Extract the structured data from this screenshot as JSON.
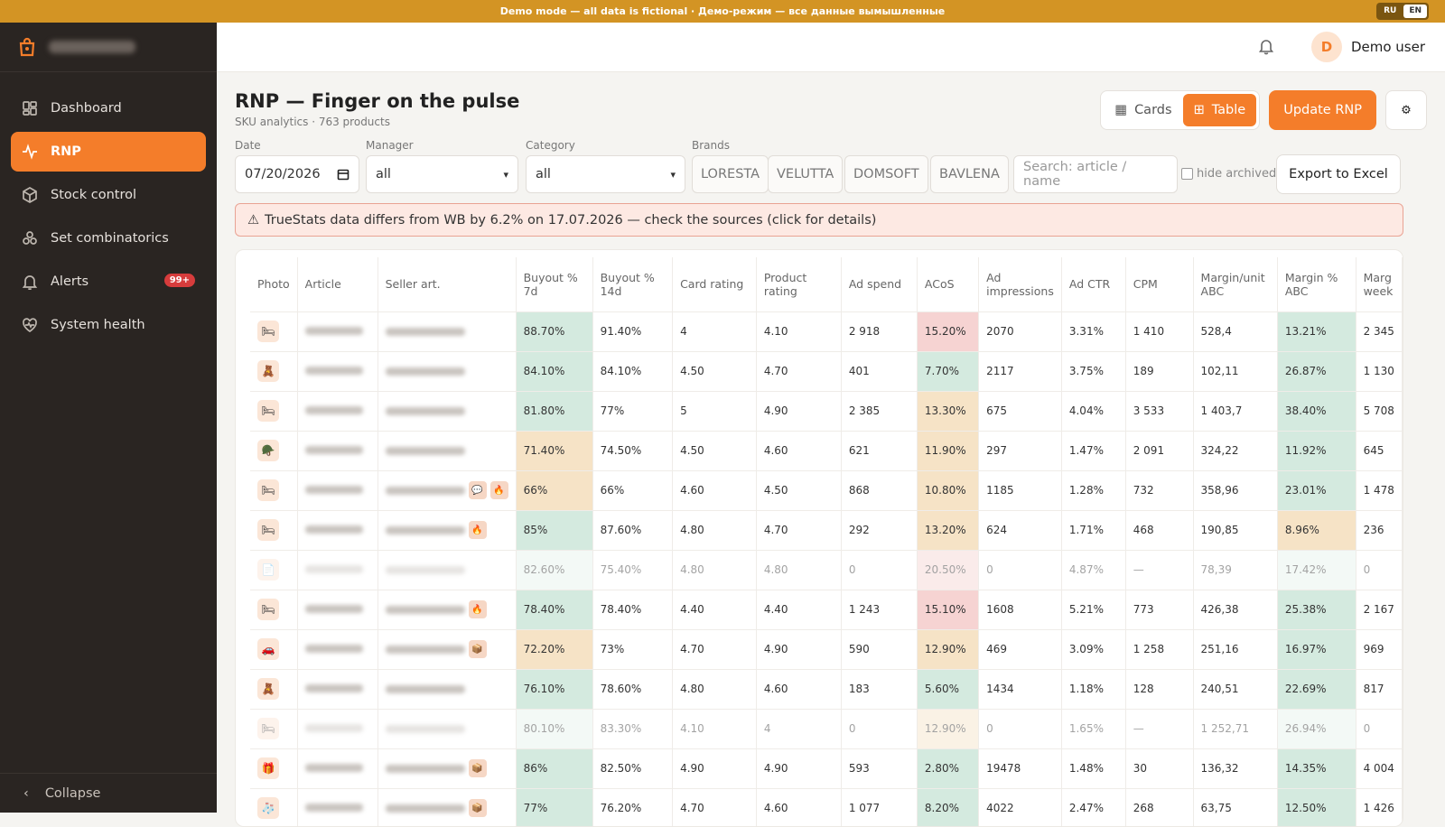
{
  "banner": {
    "text": "Demo mode — all data is fictional · Демо-режим — все данные вымышленные",
    "lang_ru": "RU",
    "lang_en": "EN"
  },
  "sidebar": {
    "items": [
      {
        "label": "Dashboard",
        "icon": "dashboard-icon"
      },
      {
        "label": "RNP",
        "icon": "pulse-icon",
        "active": true
      },
      {
        "label": "Stock control",
        "icon": "box-icon"
      },
      {
        "label": "Set combinatorics",
        "icon": "combinatorics-icon"
      },
      {
        "label": "Alerts",
        "icon": "bell-icon",
        "badge": "99+"
      },
      {
        "label": "System health",
        "icon": "heart-icon"
      }
    ],
    "collapse_label": "Collapse"
  },
  "header": {
    "user_initial": "D",
    "user_name": "Demo user"
  },
  "page": {
    "title": "RNP — Finger on the pulse",
    "subtitle": "SKU analytics · 763 products"
  },
  "toolbar": {
    "cards_label": "Cards",
    "table_label": "Table",
    "update_label": "Update RNP",
    "settings_icon": "gear-icon"
  },
  "filters": {
    "date_label": "Date",
    "date_value": "07/20/2026",
    "manager_label": "Manager",
    "manager_value": "all",
    "category_label": "Category",
    "category_value": "all",
    "brands_label": "Brands",
    "brands": [
      "LORESTA",
      "VELUTTA",
      "DOMSOFT",
      "BAVLENA"
    ],
    "search_placeholder": "Search: article / name",
    "hide_archived_label": "hide archived",
    "export_label": "Export to Excel"
  },
  "alert": {
    "text": "TrueStats data differs from WB by 6.2% on 17.07.2026 — check the sources (click for details)"
  },
  "table": {
    "headers": [
      "Photo",
      "Article",
      "Seller art.",
      "Buyout % 7d",
      "Buyout % 14d",
      "Card rating",
      "Product rating",
      "Ad spend",
      "ACoS",
      "Ad impressions",
      "Ad CTR",
      "CPM",
      "Margin/unit ABC",
      "Margin % ABC",
      "Marg week"
    ],
    "rows": [
      {
        "icon": "🛏",
        "tags": [],
        "dim": false,
        "cells": [
          "88.70%",
          "91.40%",
          "4",
          "4.10",
          "2 918",
          "15.20%",
          "2070",
          "3.31%",
          "1 410",
          "528,4",
          "13.21%",
          "2 345"
        ],
        "colors": [
          "g",
          "",
          "",
          "",
          "",
          "r",
          "",
          "",
          "",
          "",
          "g",
          ""
        ]
      },
      {
        "icon": "🧸",
        "tags": [],
        "dim": false,
        "cells": [
          "84.10%",
          "84.10%",
          "4.50",
          "4.70",
          "401",
          "7.70%",
          "2117",
          "3.75%",
          "189",
          "102,11",
          "26.87%",
          "1 130"
        ],
        "colors": [
          "g",
          "",
          "",
          "",
          "",
          "g",
          "",
          "",
          "",
          "",
          "g",
          ""
        ]
      },
      {
        "icon": "🛏",
        "tags": [],
        "dim": false,
        "cells": [
          "81.80%",
          "77%",
          "5",
          "4.90",
          "2 385",
          "13.30%",
          "675",
          "4.04%",
          "3 533",
          "1 403,7",
          "38.40%",
          "5 708"
        ],
        "colors": [
          "g",
          "",
          "",
          "",
          "",
          "y",
          "",
          "",
          "",
          "",
          "g",
          ""
        ]
      },
      {
        "icon": "🪖",
        "tags": [],
        "dim": false,
        "cells": [
          "71.40%",
          "74.50%",
          "4.50",
          "4.60",
          "621",
          "11.90%",
          "297",
          "1.47%",
          "2 091",
          "324,22",
          "11.92%",
          "645"
        ],
        "colors": [
          "y",
          "",
          "",
          "",
          "",
          "y",
          "",
          "",
          "",
          "",
          "g",
          ""
        ]
      },
      {
        "icon": "🛏",
        "tags": [
          "💬",
          "🔥"
        ],
        "dim": false,
        "cells": [
          "66%",
          "66%",
          "4.60",
          "4.50",
          "868",
          "10.80%",
          "1185",
          "1.28%",
          "732",
          "358,96",
          "23.01%",
          "1 478"
        ],
        "colors": [
          "y",
          "",
          "",
          "",
          "",
          "y",
          "",
          "",
          "",
          "",
          "g",
          ""
        ]
      },
      {
        "icon": "🛏",
        "tags": [
          "🔥"
        ],
        "dim": false,
        "cells": [
          "85%",
          "87.60%",
          "4.80",
          "4.70",
          "292",
          "13.20%",
          "624",
          "1.71%",
          "468",
          "190,85",
          "8.96%",
          "236"
        ],
        "colors": [
          "g",
          "",
          "",
          "",
          "",
          "y",
          "",
          "",
          "",
          "",
          "y",
          ""
        ]
      },
      {
        "icon": "📄",
        "tags": [],
        "dim": true,
        "cells": [
          "82.60%",
          "75.40%",
          "4.80",
          "4.80",
          "0",
          "20.50%",
          "0",
          "4.87%",
          "—",
          "78,39",
          "17.42%",
          "0"
        ],
        "colors": [
          "g",
          "",
          "",
          "",
          "",
          "r",
          "",
          "",
          "",
          "",
          "g",
          ""
        ]
      },
      {
        "icon": "🛏",
        "tags": [
          "🔥"
        ],
        "dim": false,
        "cells": [
          "78.40%",
          "78.40%",
          "4.40",
          "4.40",
          "1 243",
          "15.10%",
          "1608",
          "5.21%",
          "773",
          "426,38",
          "25.38%",
          "2 167"
        ],
        "colors": [
          "g",
          "",
          "",
          "",
          "",
          "r",
          "",
          "",
          "",
          "",
          "g",
          ""
        ]
      },
      {
        "icon": "🚗",
        "tags": [
          "📦"
        ],
        "dim": false,
        "cells": [
          "72.20%",
          "73%",
          "4.70",
          "4.90",
          "590",
          "12.90%",
          "469",
          "3.09%",
          "1 258",
          "251,16",
          "16.97%",
          "969"
        ],
        "colors": [
          "y",
          "",
          "",
          "",
          "",
          "y",
          "",
          "",
          "",
          "",
          "g",
          ""
        ]
      },
      {
        "icon": "🧸",
        "tags": [],
        "dim": false,
        "cells": [
          "76.10%",
          "78.60%",
          "4.80",
          "4.60",
          "183",
          "5.60%",
          "1434",
          "1.18%",
          "128",
          "240,51",
          "22.69%",
          "817"
        ],
        "colors": [
          "g",
          "",
          "",
          "",
          "",
          "g",
          "",
          "",
          "",
          "",
          "g",
          ""
        ]
      },
      {
        "icon": "🛏",
        "tags": [],
        "dim": true,
        "cells": [
          "80.10%",
          "83.30%",
          "4.10",
          "4",
          "0",
          "12.90%",
          "0",
          "1.65%",
          "—",
          "1 252,71",
          "26.94%",
          "0"
        ],
        "colors": [
          "g",
          "",
          "",
          "",
          "",
          "y",
          "",
          "",
          "",
          "",
          "g",
          ""
        ]
      },
      {
        "icon": "🎁",
        "tags": [
          "📦"
        ],
        "dim": false,
        "cells": [
          "86%",
          "82.50%",
          "4.90",
          "4.90",
          "593",
          "2.80%",
          "19478",
          "1.48%",
          "30",
          "136,32",
          "14.35%",
          "4 004"
        ],
        "colors": [
          "g",
          "",
          "",
          "",
          "",
          "g",
          "",
          "",
          "",
          "",
          "g",
          ""
        ]
      },
      {
        "icon": "🧦",
        "tags": [
          "📦"
        ],
        "dim": false,
        "cells": [
          "77%",
          "76.20%",
          "4.70",
          "4.60",
          "1 077",
          "8.20%",
          "4022",
          "2.47%",
          "268",
          "63,75",
          "12.50%",
          "1 426"
        ],
        "colors": [
          "g",
          "",
          "",
          "",
          "",
          "g",
          "",
          "",
          "",
          "",
          "g",
          ""
        ]
      }
    ]
  }
}
